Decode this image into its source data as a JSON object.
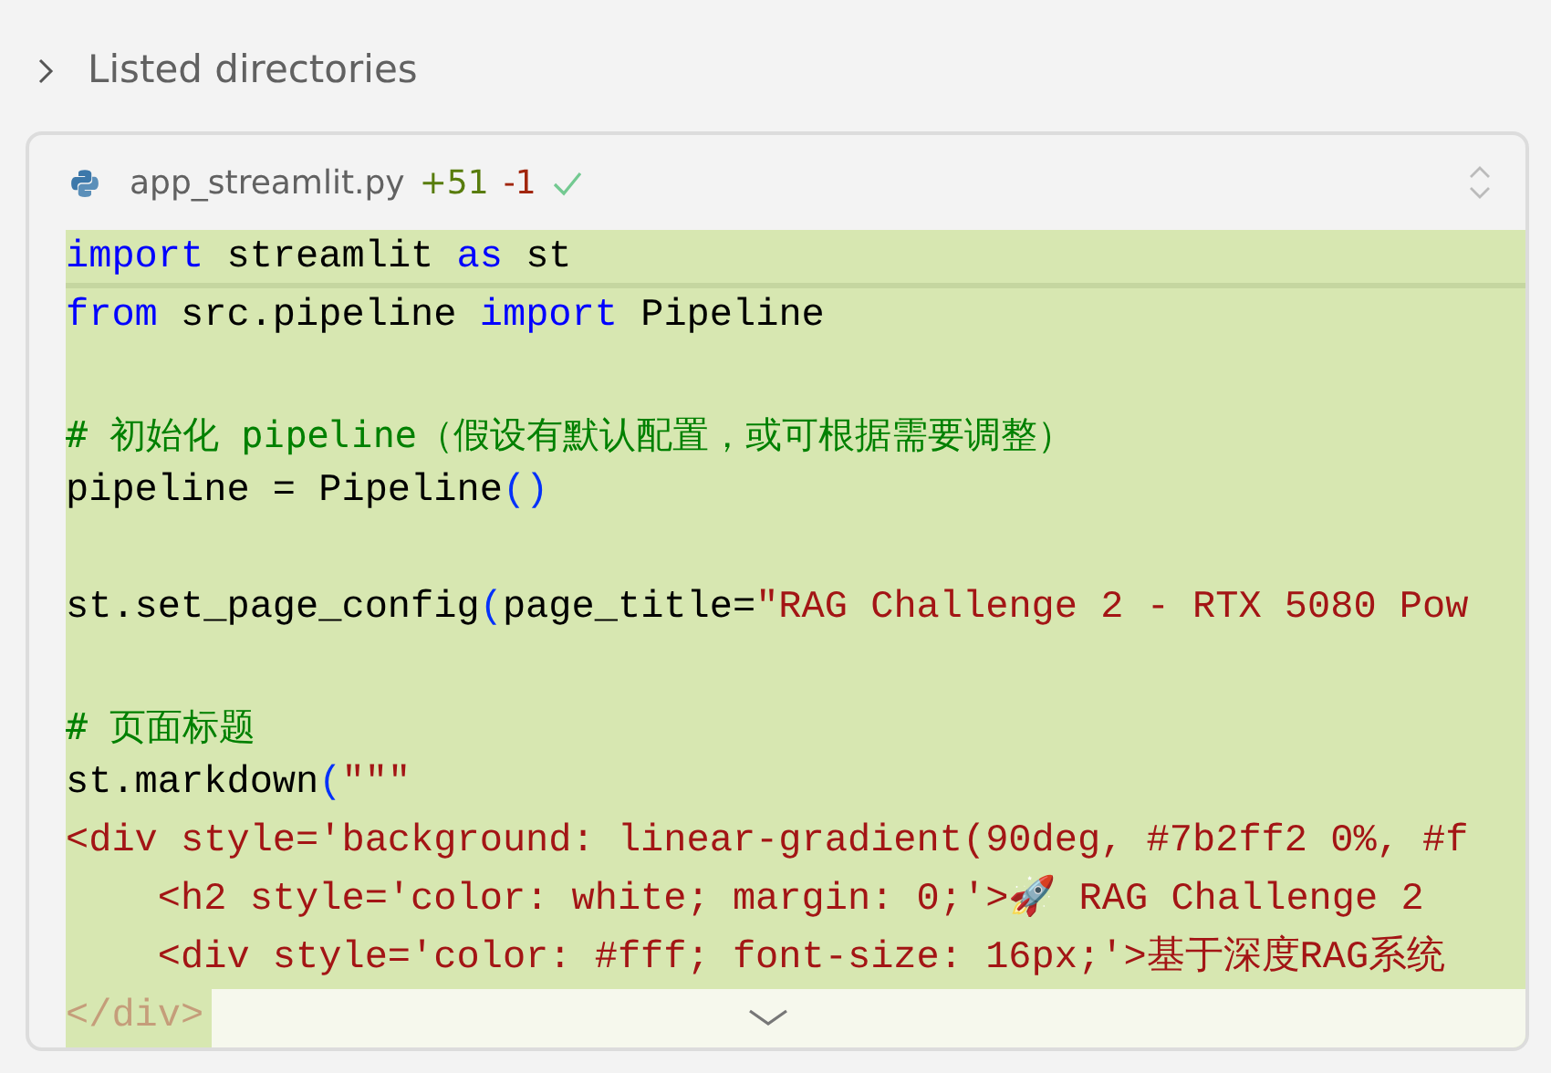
{
  "section": {
    "label": "Listed directories",
    "expanded": false
  },
  "file": {
    "name": "app_streamlit.py",
    "added": "+51",
    "removed": "-1",
    "applied": true,
    "collapsed": true,
    "lines": [
      {
        "kind": "code",
        "tokens": [
          {
            "kind": "kw",
            "text": "import"
          },
          {
            "kind": "plain",
            "text": " streamlit "
          },
          {
            "kind": "kw",
            "text": "as"
          },
          {
            "kind": "plain",
            "text": " st"
          }
        ]
      },
      {
        "kind": "code",
        "tokens": [
          {
            "kind": "kw",
            "text": "from"
          },
          {
            "kind": "plain",
            "text": " src.pipeline "
          },
          {
            "kind": "kw",
            "text": "import"
          },
          {
            "kind": "plain",
            "text": " Pipeline"
          }
        ]
      },
      {
        "kind": "blank"
      },
      {
        "kind": "code",
        "tokens": [
          {
            "kind": "comment",
            "text": "# 初始化 pipeline（假设有默认配置，或可根据需要调整）"
          }
        ]
      },
      {
        "kind": "code",
        "tokens": [
          {
            "kind": "plain",
            "text": "pipeline = Pipeline"
          },
          {
            "kind": "paren",
            "text": "()"
          }
        ]
      },
      {
        "kind": "blank"
      },
      {
        "kind": "code",
        "tokens": [
          {
            "kind": "plain",
            "text": "st.set_page_config"
          },
          {
            "kind": "paren",
            "text": "("
          },
          {
            "kind": "plain",
            "text": "page_title="
          },
          {
            "kind": "str",
            "text": "\"RAG Challenge 2 - RTX 5080 Pow"
          }
        ]
      },
      {
        "kind": "blank"
      },
      {
        "kind": "code",
        "tokens": [
          {
            "kind": "comment",
            "text": "# 页面标题"
          }
        ]
      },
      {
        "kind": "code",
        "tokens": [
          {
            "kind": "plain",
            "text": "st.markdown"
          },
          {
            "kind": "paren",
            "text": "("
          },
          {
            "kind": "str",
            "text": "\"\"\""
          }
        ]
      },
      {
        "kind": "code",
        "tokens": [
          {
            "kind": "str",
            "text": "<div style='background: linear-gradient(90deg, #7b2ff2 0%, #f"
          }
        ]
      },
      {
        "kind": "code",
        "tokens": [
          {
            "kind": "str",
            "text": "    <h2 style='color: white; margin: 0;'>🚀 RAG Challenge 2"
          }
        ]
      },
      {
        "kind": "code",
        "tokens": [
          {
            "kind": "str",
            "text": "    <div style='color: #fff; font-size: 16px;'>基于深度RAG系统"
          }
        ]
      },
      {
        "kind": "code",
        "tokens": [
          {
            "kind": "str",
            "text": "</div>"
          }
        ]
      }
    ]
  }
}
